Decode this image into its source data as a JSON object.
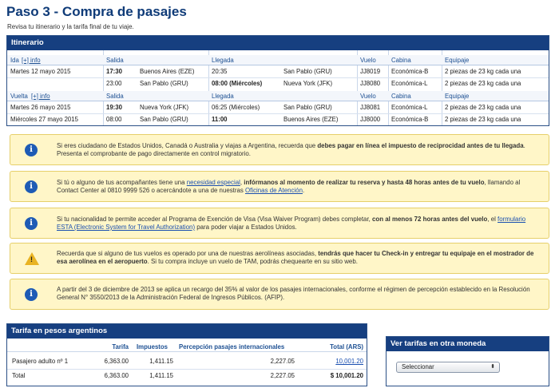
{
  "page": {
    "title": "Paso 3 - Compra de pasajes",
    "subtitle": "Revisa tu itinerario y la tarifa final de tu viaje."
  },
  "itinerary": {
    "header": "Itinerario",
    "columns": {
      "salida": "Salida",
      "llegada": "Llegada",
      "vuelo": "Vuelo",
      "cabina": "Cabina",
      "equipaje": "Equipaje"
    },
    "ida": {
      "label": "Ida",
      "info_link": "[+] info",
      "rows": [
        {
          "date": "Martes 12 mayo 2015",
          "dep_time": "17:30",
          "dep_city": "Buenos Aires (EZE)",
          "arr_time": "20:35",
          "arr_city": "San Pablo (GRU)",
          "flight": "JJ8019",
          "cabin": "Económica-B",
          "baggage": "2 piezas de 23 kg cada una"
        },
        {
          "date": "",
          "dep_time": "23:00",
          "dep_city": "San Pablo (GRU)",
          "arr_time": "08:00 (Miércoles)",
          "arr_city": "Nueva York (JFK)",
          "flight": "JJ8080",
          "cabin": "Económica-L",
          "baggage": "2 piezas de 23 kg cada una"
        }
      ]
    },
    "vuelta": {
      "label": "Vuelta",
      "info_link": "[+] info",
      "rows": [
        {
          "date": "Martes 26 mayo 2015",
          "dep_time": "19:30",
          "dep_city": "Nueva York (JFK)",
          "arr_time": "06:25 (Miércoles)",
          "arr_city": "San Pablo (GRU)",
          "flight": "JJ8081",
          "cabin": "Económica-L",
          "baggage": "2 piezas de 23 kg cada una"
        },
        {
          "date": "Miércoles 27 mayo 2015",
          "dep_time": "08:00",
          "dep_city": "San Pablo (GRU)",
          "arr_time": "11:00",
          "arr_city": "Buenos Aires (EZE)",
          "flight": "JJ8000",
          "cabin": "Económica-B",
          "baggage": "2 piezas de 23 kg cada una"
        }
      ]
    }
  },
  "notices": {
    "n1": {
      "a": "Si eres ciudadano de Estados Unidos, Canadá o Australia y viajas a Argentina, recuerda que ",
      "b": "debes pagar en línea el impuesto de reciprocidad antes de tu llegada",
      "c": ". Presenta el comprobante de pago directamente en control migratorio."
    },
    "n2": {
      "a": "Si tú o alguno de tus acompañantes tiene una ",
      "link1": "necesidad especial",
      "b": ", ",
      "bold": "infórmanos al momento de realizar tu reserva y hasta 48 horas antes de tu vuelo",
      "c": ", llamando al Contact Center al 0810 9999 526 o acercándote a una de nuestras ",
      "link2": "Oficinas de Atención",
      "d": "."
    },
    "n3": {
      "a": "Si tu nacionalidad te permite acceder al Programa de Exención de Visa (Visa Waiver Program) debes completar, ",
      "bold": "con al menos 72 horas antes del vuelo",
      "b": ", el ",
      "link": "formulario ESTA (Electronic System for Travel Authorization)",
      "c": " para poder viajar a Estados Unidos."
    },
    "n4": {
      "a": "Recuerda que si alguno de tus vuelos es operado por una de nuestras aerolíneas asociadas, ",
      "bold": "tendrás que hacer tu Check-in y entregar tu equipaje en el mostrador de esa aerolínea en el aeropuerto",
      "b": ". Si tu compra incluye un vuelo de TAM, podrás chequearte en su sitio web."
    },
    "n5": {
      "a": "A partir del 3 de diciembre de 2013 se aplica un recargo del 35% al valor de los pasajes internacionales, conforme el régimen de percepción establecido en la Resolución General N° 3550/2013 de la Administración Federal de Ingresos Públicos. (AFIP)."
    }
  },
  "fare": {
    "header": "Tarifa en pesos argentinos",
    "columns": {
      "tarifa": "Tarifa",
      "impuestos": "Impuestos",
      "percepcion": "Percepción pasajes internacionales",
      "total": "Total (ARS)"
    },
    "rows": [
      {
        "label": "Pasajero adulto nº 1",
        "tarifa": "6,363.00",
        "impuestos": "1,411.15",
        "percepcion": "2,227.05",
        "total": "10,001.20"
      }
    ],
    "total_row": {
      "label": "Total",
      "tarifa": "6,363.00",
      "impuestos": "1,411.15",
      "percepcion": "2,227.05",
      "total": "$ 10,001.20"
    }
  },
  "currency": {
    "header": "Ver tarifas en otra moneda",
    "select_value": "Seleccionar"
  },
  "colors": {
    "brand": "#163f80",
    "notice_bg": "#fff6c8",
    "info_icon": "#1e5bb5",
    "warning_icon": "#e9b323"
  },
  "icons": {
    "info": "info-icon",
    "warning": "warning-icon"
  }
}
